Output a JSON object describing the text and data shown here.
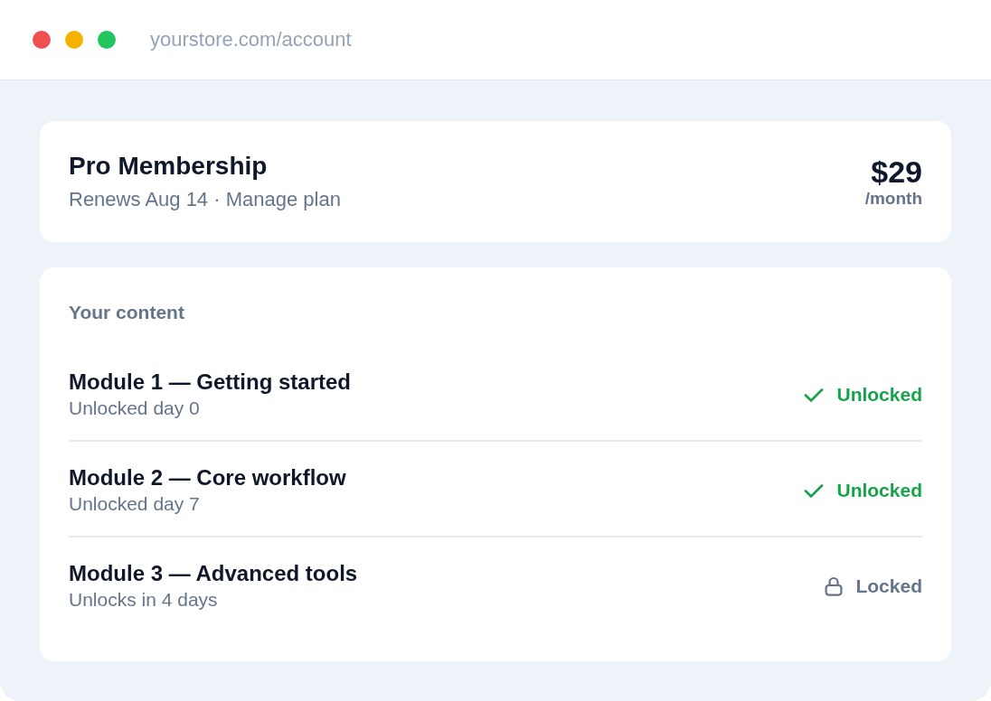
{
  "browser": {
    "url": "yourstore.com/account"
  },
  "plan": {
    "name": "Pro Membership",
    "subtitle": "Renews Aug 14 · Manage plan",
    "price": "$29",
    "period": "/month"
  },
  "content": {
    "heading": "Your content",
    "modules": [
      {
        "title": "Module 1 — Getting started",
        "subtitle": "Unlocked day 0",
        "status": {
          "kind": "unlocked",
          "label": "Unlocked"
        }
      },
      {
        "title": "Module 2 — Core workflow",
        "subtitle": "Unlocked day 7",
        "status": {
          "kind": "unlocked",
          "label": "Unlocked"
        }
      },
      {
        "title": "Module 3 — Advanced tools",
        "subtitle": "Unlocks in 4 days",
        "status": {
          "kind": "locked",
          "label": "Locked"
        }
      }
    ]
  }
}
